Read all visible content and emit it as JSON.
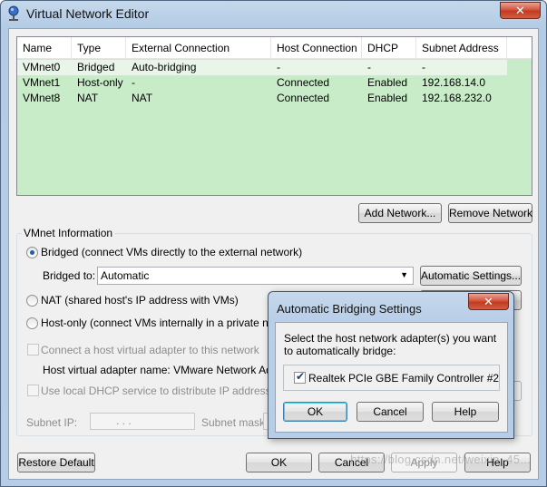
{
  "window": {
    "title": "Virtual Network Editor",
    "close_glyph": "✕"
  },
  "network_table": {
    "columns": [
      "Name",
      "Type",
      "External Connection",
      "Host Connection",
      "DHCP",
      "Subnet Address"
    ],
    "rows": [
      {
        "name": "VMnet0",
        "type": "Bridged",
        "external": "Auto-bridging",
        "host": "-",
        "dhcp": "-",
        "subnet": "-"
      },
      {
        "name": "VMnet1",
        "type": "Host-only",
        "external": "-",
        "host": "Connected",
        "dhcp": "Enabled",
        "subnet": "192.168.14.0"
      },
      {
        "name": "VMnet8",
        "type": "NAT",
        "external": "NAT",
        "host": "Connected",
        "dhcp": "Enabled",
        "subnet": "192.168.232.0"
      }
    ]
  },
  "table_buttons": {
    "add_network": "Add Network...",
    "remove_network": "Remove Network"
  },
  "vmnet_info": {
    "group_label": "VMnet Information",
    "bridged_label": "Bridged (connect VMs directly to the external network)",
    "bridged_to_label": "Bridged to:",
    "bridged_to_value": "Automatic",
    "auto_settings_button": "Automatic Settings...",
    "nat_label": "NAT (shared host's IP address with VMs)",
    "hostonly_label": "Host-only (connect VMs internally in a private networ",
    "connect_adapter_label": "Connect a host virtual adapter to this network",
    "adapter_name_label": "Host virtual adapter name: VMware Network Adapte",
    "dhcp_label": "Use local DHCP service to distribute IP address to VM",
    "subnet_ip_label": "Subnet IP:",
    "subnet_ip_value": ".   .   .",
    "subnet_mask_label": "Subnet mask:"
  },
  "bottom_buttons": {
    "restore_default": "Restore Default",
    "ok": "OK",
    "cancel": "Cancel",
    "apply": "Apply",
    "help": "Help"
  },
  "popup": {
    "title": "Automatic Bridging Settings",
    "close_glyph": "✕",
    "instruction": "Select the host network adapter(s) you want to automatically bridge:",
    "adapter_label": "Realtek PCIe GBE Family Controller #2",
    "adapter_checked": true,
    "ok": "OK",
    "cancel": "Cancel",
    "help": "Help"
  },
  "watermark": "https://blog.csdn.net/weixin_45..."
}
